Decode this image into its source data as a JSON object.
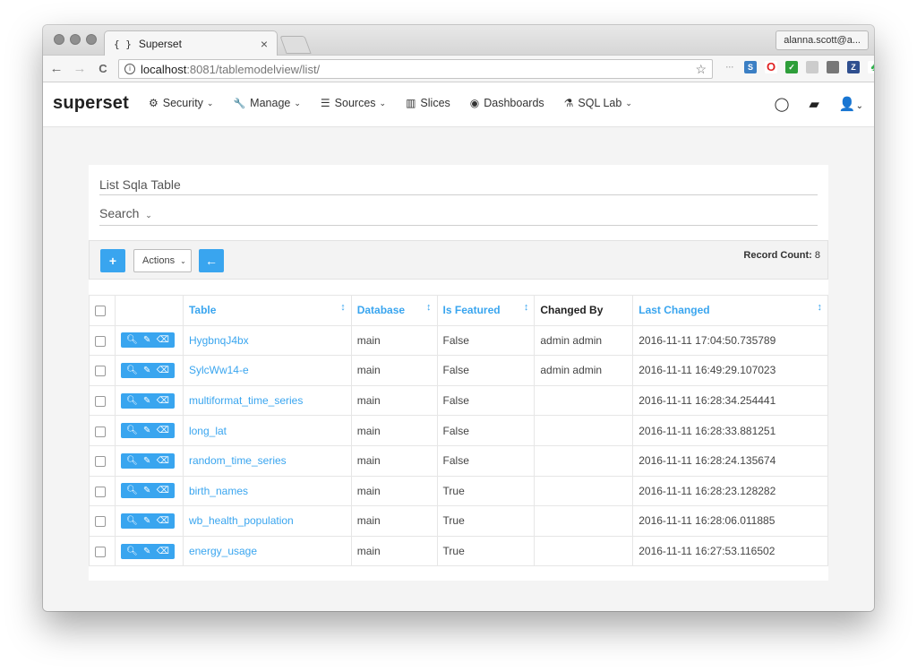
{
  "browser": {
    "tab_title": "Superset",
    "tab_favicon": "{ }",
    "tab_close": "×",
    "profile_label": "alanna.scott@a...",
    "url_host": "localhost",
    "url_path": ":8081/tablemodelview/list/",
    "back": "←",
    "forward": "→",
    "reload": "C",
    "star": "☆"
  },
  "app": {
    "brand": "superset",
    "menu": [
      {
        "icon": "⚙",
        "label": "Security",
        "has_caret": true
      },
      {
        "icon": "🔧",
        "label": "Manage",
        "has_caret": true
      },
      {
        "icon": "☰",
        "label": "Sources",
        "has_caret": true
      },
      {
        "icon": "▥",
        "label": "Slices",
        "has_caret": false
      },
      {
        "icon": "◉",
        "label": "Dashboards",
        "has_caret": false
      },
      {
        "icon": "⚗",
        "label": "SQL Lab",
        "has_caret": true
      }
    ],
    "caret": "⌄"
  },
  "list": {
    "title": "List Sqla Table",
    "search_label": "Search",
    "actions_label": "Actions",
    "add_label": "+",
    "back_label": "←",
    "record_count_label": "Record Count:",
    "record_count": "8",
    "columns": [
      "Table",
      "Database",
      "Is Featured",
      "Changed By",
      "Last Changed"
    ],
    "sort_icon": "↕",
    "rows": [
      {
        "table": "HygbnqJ4bx",
        "database": "main",
        "featured": "False",
        "changed_by": "admin admin",
        "last_changed": "2016-11-11 17:04:50.735789"
      },
      {
        "table": "SylcWw14-e",
        "database": "main",
        "featured": "False",
        "changed_by": "admin admin",
        "last_changed": "2016-11-11 16:49:29.107023"
      },
      {
        "table": "multiformat_time_series",
        "database": "main",
        "featured": "False",
        "changed_by": "",
        "last_changed": "2016-11-11 16:28:34.254441"
      },
      {
        "table": "long_lat",
        "database": "main",
        "featured": "False",
        "changed_by": "",
        "last_changed": "2016-11-11 16:28:33.881251"
      },
      {
        "table": "random_time_series",
        "database": "main",
        "featured": "False",
        "changed_by": "",
        "last_changed": "2016-11-11 16:28:24.135674"
      },
      {
        "table": "birth_names",
        "database": "main",
        "featured": "True",
        "changed_by": "",
        "last_changed": "2016-11-11 16:28:23.128282"
      },
      {
        "table": "wb_health_population",
        "database": "main",
        "featured": "True",
        "changed_by": "",
        "last_changed": "2016-11-11 16:28:06.011885"
      },
      {
        "table": "energy_usage",
        "database": "main",
        "featured": "True",
        "changed_by": "",
        "last_changed": "2016-11-11 16:27:53.116502"
      }
    ]
  },
  "colors": {
    "accent": "#39a5ef"
  }
}
